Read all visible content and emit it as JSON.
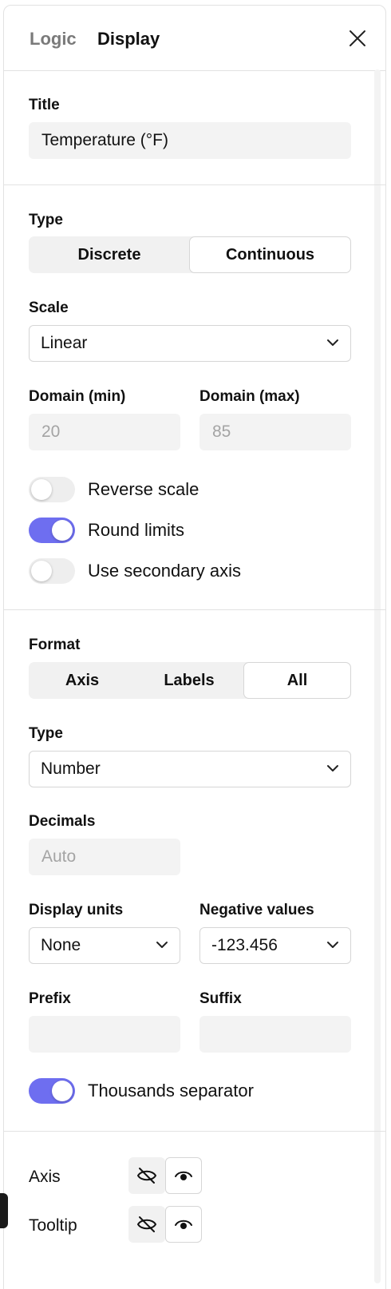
{
  "tabs": {
    "logic": "Logic",
    "display": "Display"
  },
  "title_section": {
    "label": "Title",
    "value": "Temperature (°F)"
  },
  "type_section": {
    "label": "Type",
    "options": [
      "Discrete",
      "Continuous"
    ],
    "selected": "Continuous"
  },
  "scale": {
    "label": "Scale",
    "value": "Linear"
  },
  "domain": {
    "min_label": "Domain (min)",
    "min_placeholder": "20",
    "max_label": "Domain (max)",
    "max_placeholder": "85"
  },
  "toggles": {
    "reverse_scale": {
      "label": "Reverse scale",
      "on": false
    },
    "round_limits": {
      "label": "Round limits",
      "on": true
    },
    "secondary_axis": {
      "label": "Use secondary axis",
      "on": false
    },
    "thousands_separator": {
      "label": "Thousands separator",
      "on": true
    }
  },
  "format": {
    "label": "Format",
    "options": [
      "Axis",
      "Labels",
      "All"
    ],
    "selected": "All"
  },
  "format_type": {
    "label": "Type",
    "value": "Number"
  },
  "decimals": {
    "label": "Decimals",
    "placeholder": "Auto"
  },
  "display_units": {
    "label": "Display units",
    "value": "None"
  },
  "negative_values": {
    "label": "Negative values",
    "value": "-123.456"
  },
  "prefix": {
    "label": "Prefix",
    "value": ""
  },
  "suffix": {
    "label": "Suffix",
    "value": ""
  },
  "visibility": {
    "axis": {
      "label": "Axis",
      "state": "visible"
    },
    "tooltip": {
      "label": "Tooltip",
      "state": "visible"
    }
  },
  "colors": {
    "accent": "#6e6ef0",
    "field_bg": "#f3f3f3",
    "border": "#d6d6d6"
  },
  "icons": {
    "close": "close-icon",
    "hidden": "eye-off-icon",
    "visible": "eye-icon",
    "chevron": "chevron-down-icon"
  }
}
